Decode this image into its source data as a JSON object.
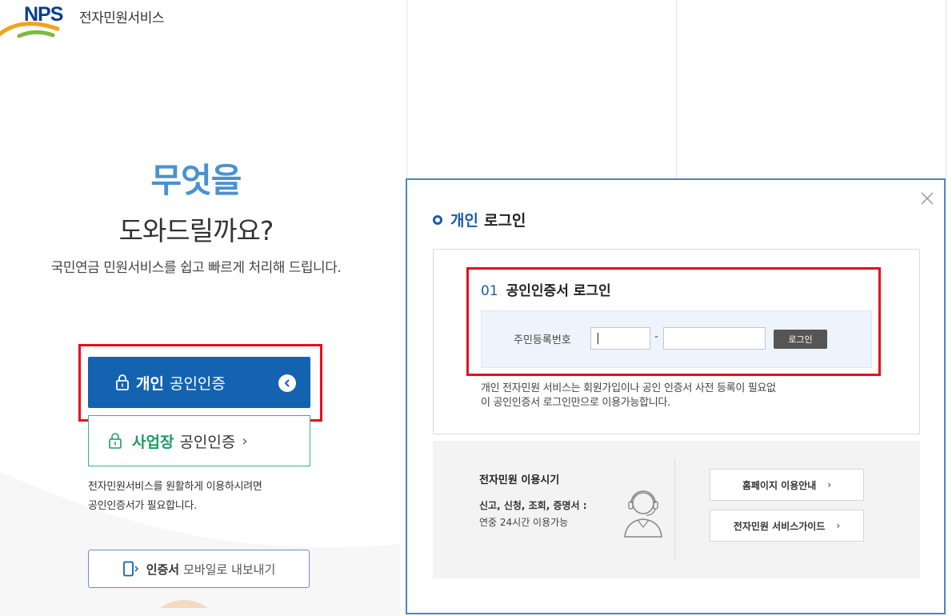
{
  "logo": {
    "brand": "NPS",
    "subtitle": "전자민원서비스"
  },
  "hero": {
    "line1": "무엇을",
    "line2": "도와드릴까요?",
    "line3": "국민연금 민원서비스를 쉽고 빠르게 처리해 드립니다."
  },
  "buttons": {
    "personal_strong": "개인",
    "personal_rest": "공인인증",
    "business_strong": "사업장",
    "business_rest": "공인인증",
    "business_chevron": "›",
    "mobile_strong": "인증서",
    "mobile_rest": "모바일로 내보내기"
  },
  "left_note": {
    "line1": "전자민원서비스를 원활하게 이용하시려면",
    "line2": "공인인증서가 필요합니다."
  },
  "popup": {
    "title_blue": "개인",
    "title_rest": "로그인",
    "step_num": "01",
    "step_label": "공인인증서 로그인",
    "ssn_label": "주민등록번호",
    "ssn_front_value": "|",
    "ssn_dash": "-",
    "ssn_back_value": "",
    "login_button": "로그인",
    "desc_line1": "개인 전자민원 서비스는 회원가입이나 공인 인증서 사전 등록이 필요없",
    "desc_line2": "이 공인인증서 로그인만으로 이용가능합니다.",
    "info_title": "전자민원 이용시기",
    "info_sub1": "신고, 신청, 조회, 증명서 :",
    "info_sub2": "연중 24시간 이용가능",
    "guide_button_1": "홈페이지 이용안내",
    "guide_button_2": "전자민원 서비스가이드",
    "guide_chevron": "›"
  },
  "colors": {
    "primary_blue": "#1463b0",
    "hero_blue": "#4a92cf",
    "business_green": "#2fb590",
    "highlight_red": "#e60d1b",
    "popup_border": "#4a86c5"
  },
  "icons": [
    "lock-icon",
    "chevron-left-circle-icon",
    "phone-export-icon",
    "close-icon",
    "agent-headset-icon"
  ]
}
